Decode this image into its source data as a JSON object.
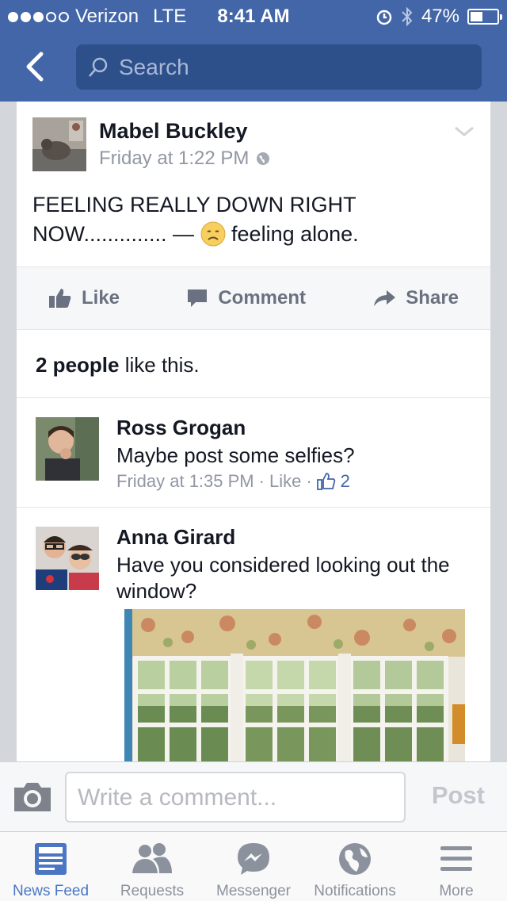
{
  "status": {
    "carrier": "Verizon",
    "network": "LTE",
    "time": "8:41 AM",
    "battery": "47%",
    "battery_level": 0.47
  },
  "search": {
    "placeholder": "Search"
  },
  "post": {
    "author": "Mabel Buckley",
    "time": "Friday at 1:22 PM",
    "text_before": "FEELING REALLY DOWN RIGHT NOW.............. — ",
    "text_after": " feeling alone.",
    "actions": {
      "like": "Like",
      "comment": "Comment",
      "share": "Share"
    },
    "likes_bold": "2 people",
    "likes_rest": " like this."
  },
  "comments": [
    {
      "author": "Ross Grogan",
      "text": "Maybe post some selfies?",
      "time": "Friday at 1:35 PM",
      "like": "Like",
      "like_count": "2"
    },
    {
      "author": "Anna Girard",
      "text": "Have you considered looking out the window?"
    }
  ],
  "composer": {
    "placeholder": "Write a comment...",
    "post": "Post"
  },
  "tabs": [
    {
      "label": "News Feed",
      "icon": "news-feed-icon",
      "active": true
    },
    {
      "label": "Requests",
      "icon": "friends-icon"
    },
    {
      "label": "Messenger",
      "icon": "messenger-icon"
    },
    {
      "label": "Notifications",
      "icon": "globe-icon"
    },
    {
      "label": "More",
      "icon": "menu-icon"
    }
  ],
  "colors": {
    "brand": "#4266a8",
    "accent": "#4a76c4"
  }
}
